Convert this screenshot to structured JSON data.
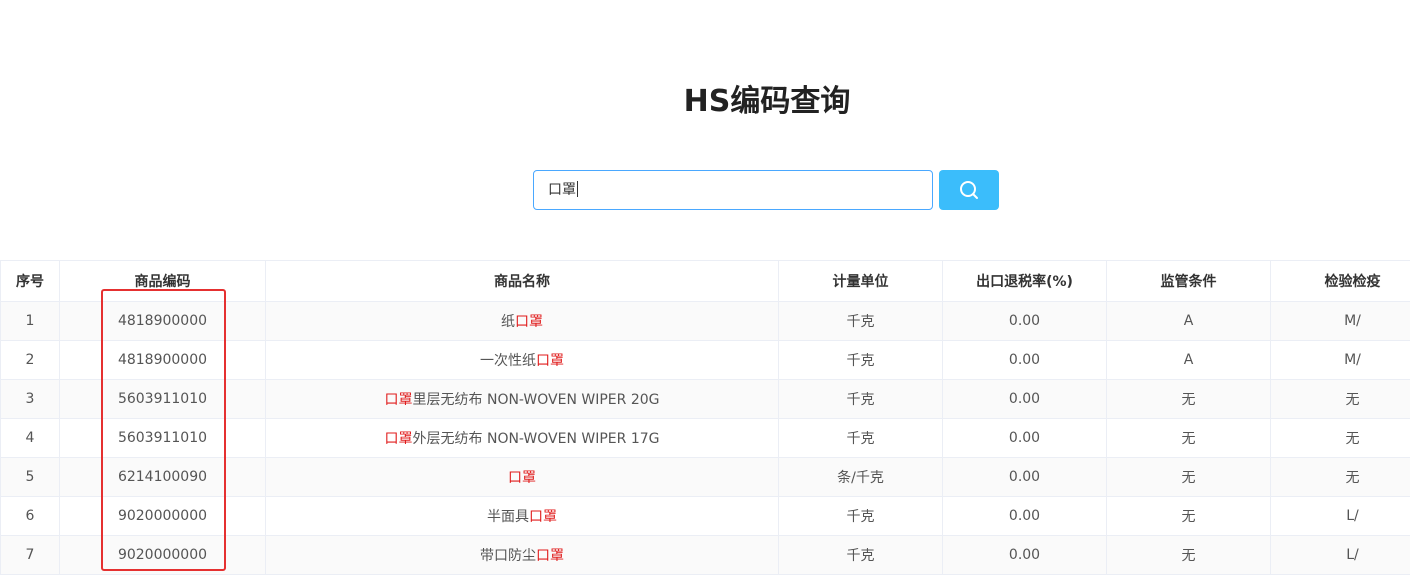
{
  "page": {
    "title": "HS编码查询"
  },
  "search": {
    "value": "口罩",
    "button_icon": "search-icon"
  },
  "colors": {
    "accent": "#3bbdfb",
    "input_border": "#4aa8ff",
    "highlight": "#e01b1b",
    "annotation_box": "#e53030"
  },
  "table": {
    "headers": [
      "序号",
      "商品编码",
      "商品名称",
      "计量单位",
      "出口退税率(%)",
      "监管条件",
      "检验检疫"
    ],
    "rows": [
      {
        "index": "1",
        "code": "4818900000",
        "name_pre": "纸",
        "name_hl": "口罩",
        "name_post": "",
        "unit": "千克",
        "rebate": "0.00",
        "supervision": "A",
        "inspection": "M/"
      },
      {
        "index": "2",
        "code": "4818900000",
        "name_pre": "一次性纸",
        "name_hl": "口罩",
        "name_post": "",
        "unit": "千克",
        "rebate": "0.00",
        "supervision": "A",
        "inspection": "M/"
      },
      {
        "index": "3",
        "code": "5603911010",
        "name_pre": "",
        "name_hl": "口罩",
        "name_post": "里层无纺布 NON-WOVEN WIPER 20G",
        "unit": "千克",
        "rebate": "0.00",
        "supervision": "无",
        "inspection": "无"
      },
      {
        "index": "4",
        "code": "5603911010",
        "name_pre": "",
        "name_hl": "口罩",
        "name_post": "外层无纺布 NON-WOVEN WIPER 17G",
        "unit": "千克",
        "rebate": "0.00",
        "supervision": "无",
        "inspection": "无"
      },
      {
        "index": "5",
        "code": "6214100090",
        "name_pre": "",
        "name_hl": "口罩",
        "name_post": "",
        "unit": "条/千克",
        "rebate": "0.00",
        "supervision": "无",
        "inspection": "无"
      },
      {
        "index": "6",
        "code": "9020000000",
        "name_pre": "半面具",
        "name_hl": "口罩",
        "name_post": "",
        "unit": "千克",
        "rebate": "0.00",
        "supervision": "无",
        "inspection": "L/"
      },
      {
        "index": "7",
        "code": "9020000000",
        "name_pre": "带口防尘",
        "name_hl": "口罩",
        "name_post": "",
        "unit": "千克",
        "rebate": "0.00",
        "supervision": "无",
        "inspection": "L/"
      }
    ]
  }
}
